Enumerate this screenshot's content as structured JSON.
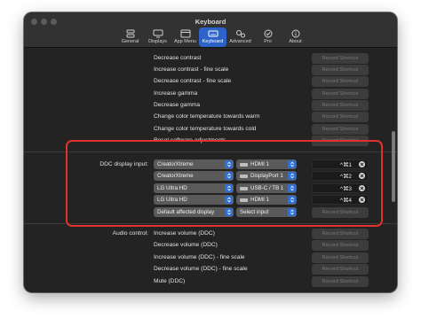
{
  "window": {
    "title": "Keyboard"
  },
  "toolbar": {
    "tabs": [
      {
        "label": "General",
        "icon": "general-icon"
      },
      {
        "label": "Displays",
        "icon": "displays-icon"
      },
      {
        "label": "App Menu",
        "icon": "app-menu-icon"
      },
      {
        "label": "Keyboard",
        "icon": "keyboard-icon",
        "active": true
      },
      {
        "label": "Advanced",
        "icon": "advanced-icon"
      },
      {
        "label": "Pro",
        "icon": "pro-icon"
      },
      {
        "label": "About",
        "icon": "about-icon"
      }
    ]
  },
  "record_label": "Record Shortcut",
  "top_rows": [
    "Decrease contrast",
    "Increase contrast - fine scale",
    "Decrease contrast - fine scale",
    "Increase gamma",
    "Decrease gamma",
    "Change color temperature towards warm",
    "Change color temperature towards cold",
    "Reset software adjustments"
  ],
  "ddc": {
    "label": "DDC display input:",
    "rows": [
      {
        "display": "CreatorXtreme",
        "input": "HDMI 1",
        "shortcut": "^⌘1"
      },
      {
        "display": "CreatorXtreme",
        "input": "DisplayPort 1",
        "shortcut": "^⌘2"
      },
      {
        "display": "LG Ultra HD",
        "input": "USB-C / TB 1",
        "shortcut": "^⌘3"
      },
      {
        "display": "LG Ultra HD",
        "input": "HDMI 1",
        "shortcut": "^⌘4"
      }
    ],
    "new_row": {
      "display": "Default affected display",
      "input": "Select input"
    }
  },
  "audio": {
    "label": "Audio control:",
    "rows": [
      "Increase volume (DDC)",
      "Decrease volume (DDC)",
      "Increase volume (DDC) - fine scale",
      "Decrease volume (DDC) - fine scale",
      "Mute (DDC)"
    ]
  },
  "colors": {
    "accent": "#2d63c8",
    "highlight": "#e0312c",
    "window_bg": "#232323"
  }
}
